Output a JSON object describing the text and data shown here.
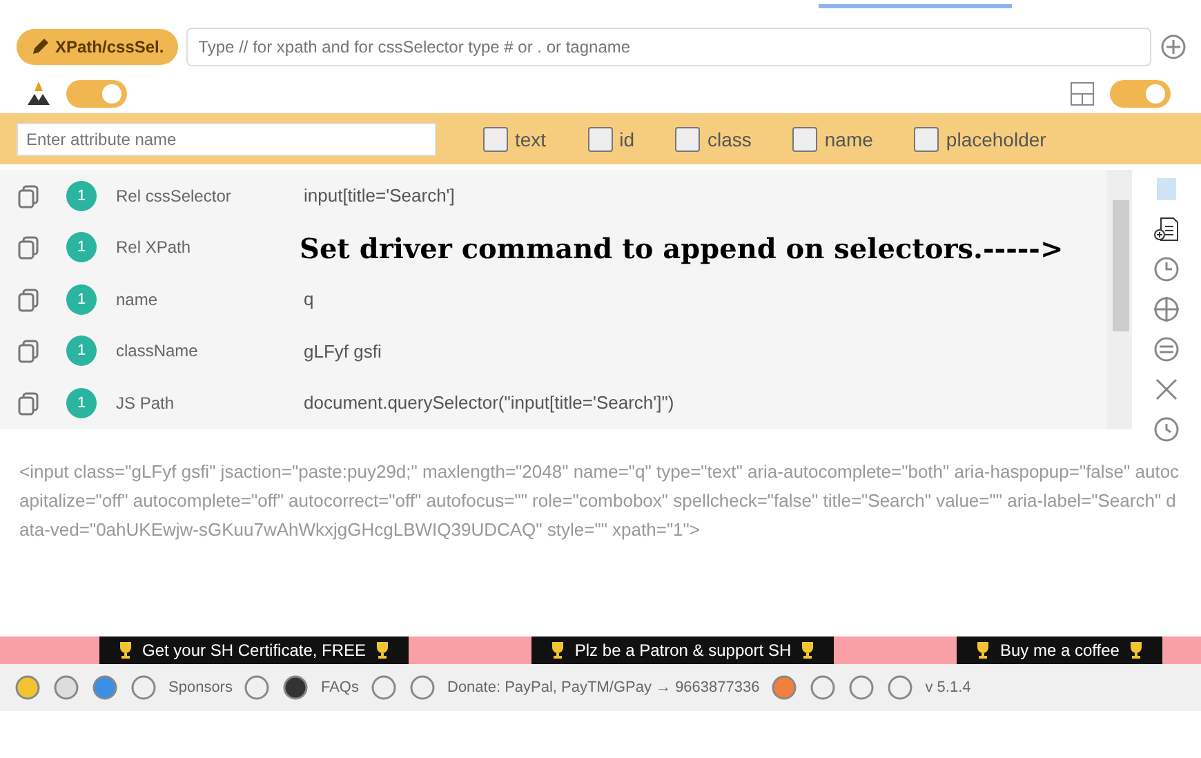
{
  "selector_button": {
    "label": "XPath/cssSel."
  },
  "selector_input": {
    "placeholder": "Type // for xpath and for cssSelector type # or . or tagname"
  },
  "toggles": [
    {
      "on": true
    },
    {
      "on": true
    }
  ],
  "attribute_input": {
    "placeholder": "Enter attribute name"
  },
  "attribute_options": [
    {
      "label": "text",
      "checked": false
    },
    {
      "label": "id",
      "checked": false
    },
    {
      "label": "class",
      "checked": false
    },
    {
      "label": "name",
      "checked": false
    },
    {
      "label": "placeholder",
      "checked": false
    }
  ],
  "results": [
    {
      "badge": "1",
      "label": "Rel cssSelector",
      "value": "input[title='Search']"
    },
    {
      "badge": "1",
      "label": "Rel XPath"
    },
    {
      "badge": "1",
      "label": "name",
      "value": "q"
    },
    {
      "badge": "1",
      "label": "className",
      "value": "gLFyf gsfi"
    },
    {
      "badge": "1",
      "label": "JS Path",
      "value": "document.querySelector(\"input[title='Search']\")"
    }
  ],
  "annotation": "Set driver command to append on selectors.----->",
  "html_snippet": "<input class=\"gLFyf gsfi\" jsaction=\"paste:puy29d;\" maxlength=\"2048\" name=\"q\" type=\"text\" aria-autocomplete=\"both\" aria-haspopup=\"false\" autocapitalize=\"off\" autocomplete=\"off\" autocorrect=\"off\" autofocus=\"\" role=\"combobox\" spellcheck=\"false\" title=\"Search\" value=\"\" aria-label=\"Search\" data-ved=\"0ahUKEwjw-sGKuu7wAhWkxjgGHcgLBWIQ39UDCAQ\" style=\"\" xpath=\"1\">",
  "banners": [
    "Get your SH Certificate, FREE",
    "Plz be a Patron & support SH",
    "Buy me a coffee"
  ],
  "footer": {
    "sponsors": "Sponsors",
    "faqs": "FAQs",
    "donate": "Donate: PayPal, PayTM/GPay → 9663877336",
    "version": "v 5.1.4"
  }
}
